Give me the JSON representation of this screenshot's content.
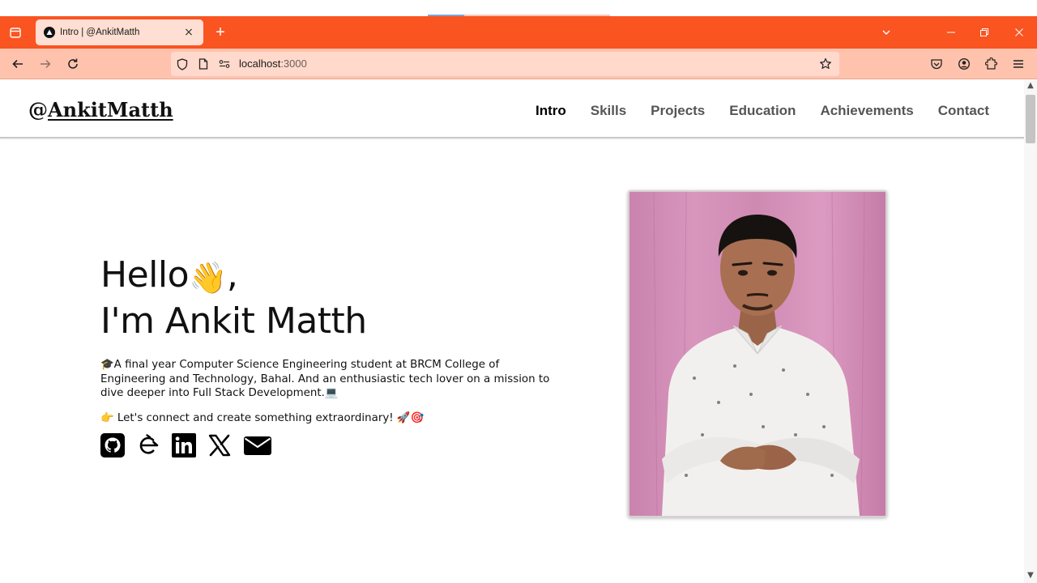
{
  "browser": {
    "tab_title": "Intro | @AnkitMatth",
    "tab_close": "×",
    "new_tab": "+",
    "url_host": "localhost",
    "url_port": ":3000"
  },
  "site": {
    "logo_prefix": "@",
    "logo_name": "AnkitMatth",
    "nav": [
      "Intro",
      "Skills",
      "Projects",
      "Education",
      "Achievements",
      "Contact"
    ],
    "active_nav": "Intro"
  },
  "hero": {
    "greeting": "Hello",
    "greeting_emoji": "👋",
    "greeting_suffix": ",",
    "name_line": "I'm Ankit Matth",
    "bio": "🎓A final year Computer Science Engineering student at BRCM College of Engineering and Technology, Bahal. And an enthusiastic tech lover on a mission to dive deeper into Full Stack Development.💻",
    "cta": "👉 Let's connect and create something extraordinary! 🚀🎯"
  },
  "socials": [
    "github-icon",
    "codechef-icon",
    "linkedin-icon",
    "x-icon",
    "email-icon"
  ],
  "colors": {
    "tabbar": "#fa5421",
    "navbar": "#ffc3ad",
    "active_tab": "#ffdfd3",
    "photo_bg": "#d28db4"
  }
}
